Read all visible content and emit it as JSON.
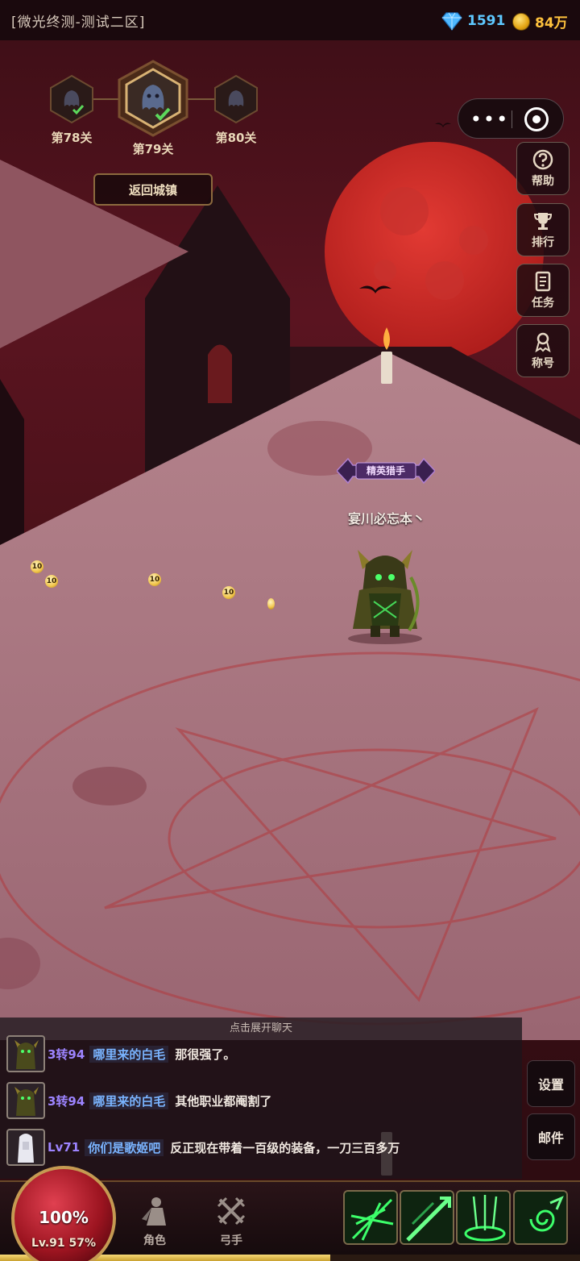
{
  "header": {
    "server_name": "[微光终测-测试二区]",
    "gems": "1591",
    "gold": "84万"
  },
  "stages": {
    "prev": "第78关",
    "current": "第79关",
    "next": "第80关",
    "return_label": "返回城镇"
  },
  "side_menu": {
    "help": "帮助",
    "rank": "排行",
    "task": "任务",
    "title": "称号"
  },
  "character": {
    "badge": "精英猎手",
    "name": "宴川必忘本丶"
  },
  "drops": [
    "10",
    "10",
    "10",
    "10"
  ],
  "chat": {
    "expand": "点击展开聊天",
    "messages": [
      {
        "level": "3转94",
        "nick": "哪里来的白毛",
        "text": "那很强了。"
      },
      {
        "level": "3转94",
        "nick": "哪里来的白毛",
        "text": "其他职业都阉割了"
      },
      {
        "level": "Lv71",
        "nick": "你们是歌姬吧",
        "text": "反正现在带着一百级的装备，一刀三百多万"
      }
    ]
  },
  "right_menu": {
    "settings": "设置",
    "mail": "邮件"
  },
  "player": {
    "hp": "100%",
    "level": "Lv.91",
    "exp": "57%",
    "exp_fraction": 0.57
  },
  "nav": {
    "role": "角色",
    "class": "弓手"
  },
  "colors": {
    "gem": "#5ec8ff",
    "gold": "#ffc23d",
    "moon": "#c52a26",
    "chat_nick": "#7ab4ff",
    "chat_level": "#9d84ff"
  }
}
